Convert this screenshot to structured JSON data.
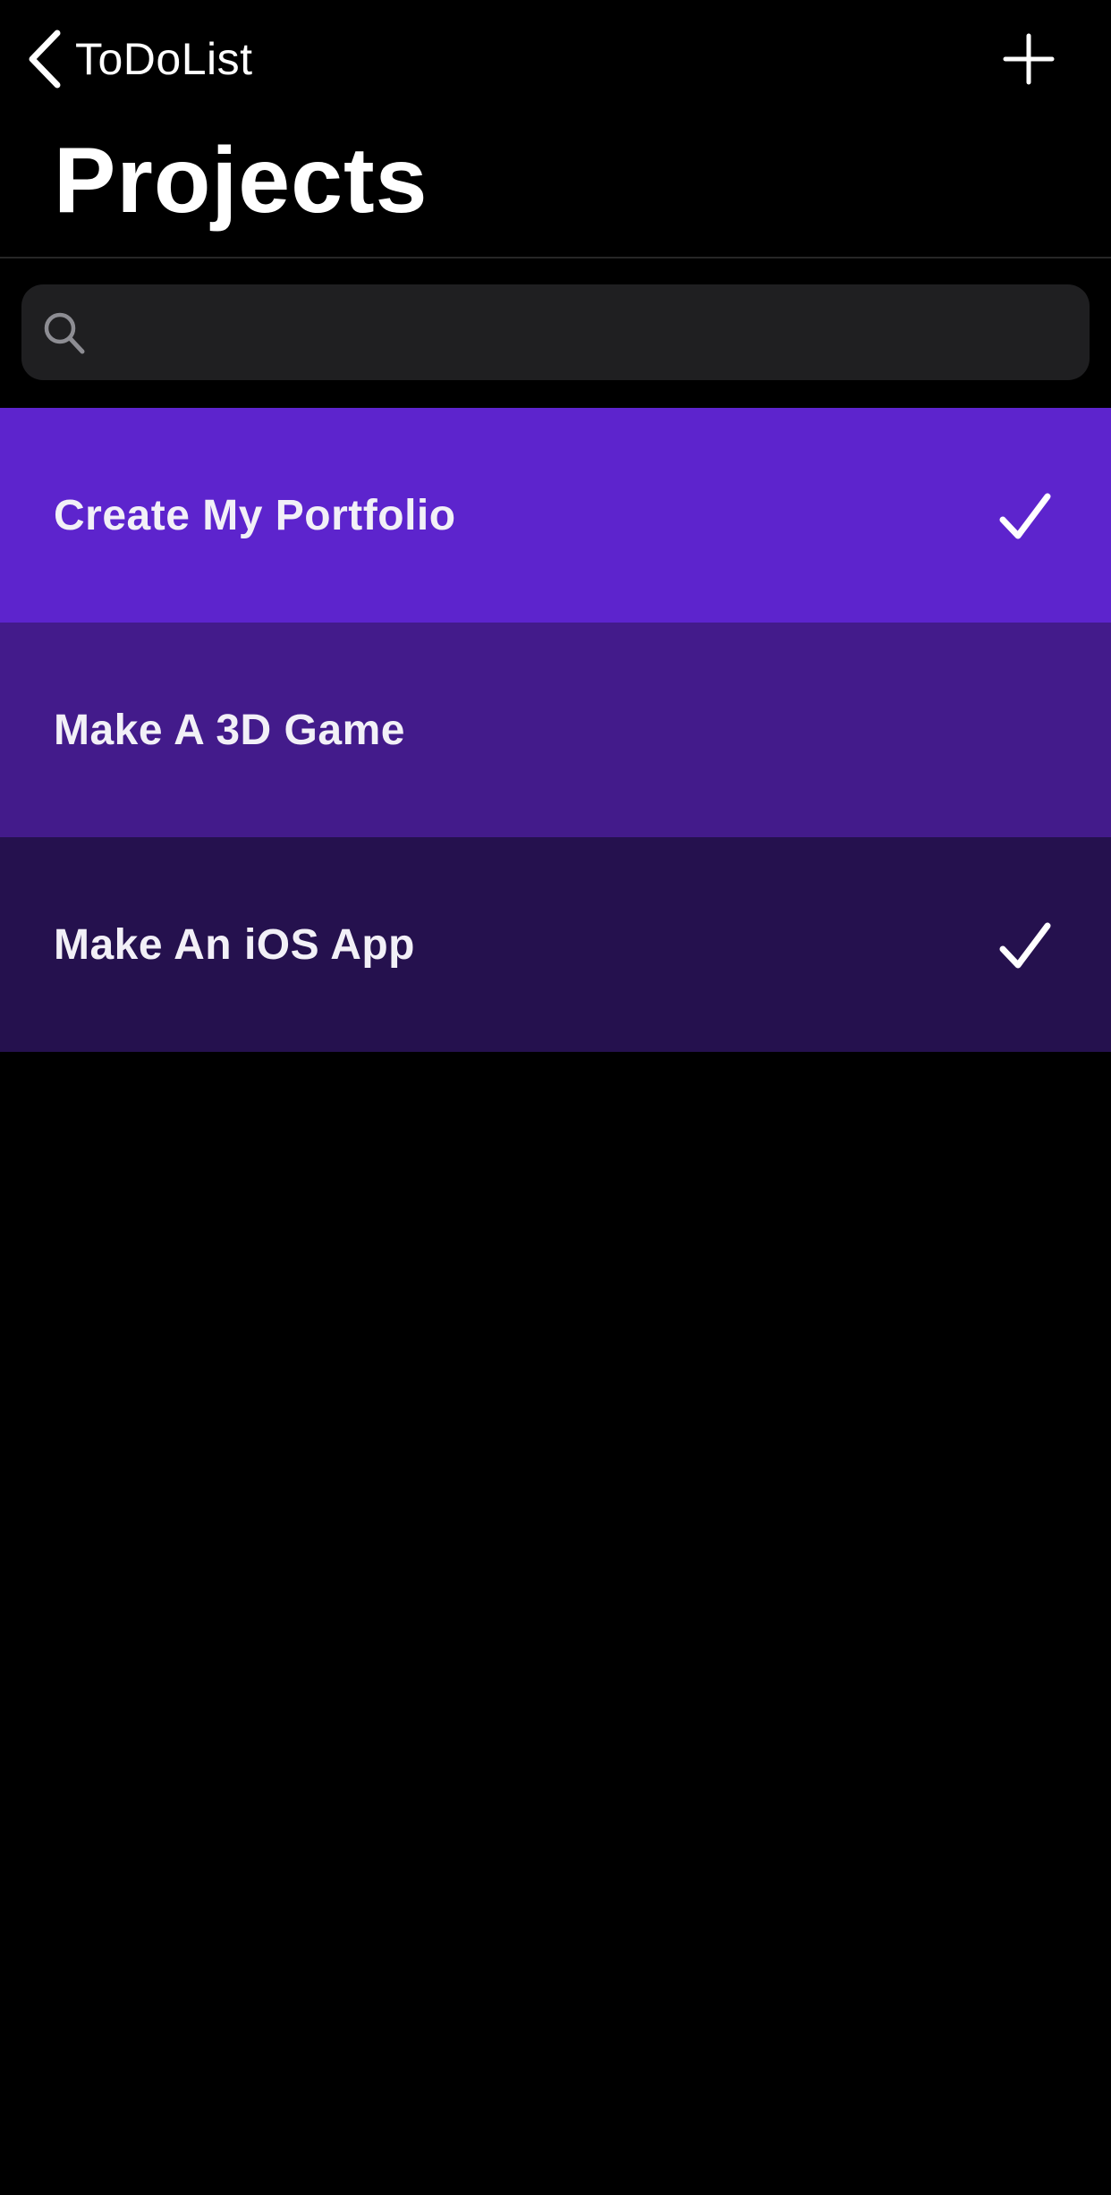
{
  "nav": {
    "back_label": "ToDoList",
    "back_icon": "chevron-left-icon",
    "add_icon": "plus-icon"
  },
  "page_title": "Projects",
  "search": {
    "placeholder": "",
    "value": "",
    "icon": "search-icon"
  },
  "projects": [
    {
      "name": "Create My Portfolio",
      "completed": true,
      "color": "#5d24cd"
    },
    {
      "name": "Make A 3D Game",
      "completed": false,
      "color": "#431b8b"
    },
    {
      "name": "Make An iOS App",
      "completed": true,
      "color": "#25114e"
    }
  ],
  "colors": {
    "background": "#000000",
    "search_background": "#1f1f21",
    "divider": "#262626",
    "foreground": "#ffffff"
  }
}
